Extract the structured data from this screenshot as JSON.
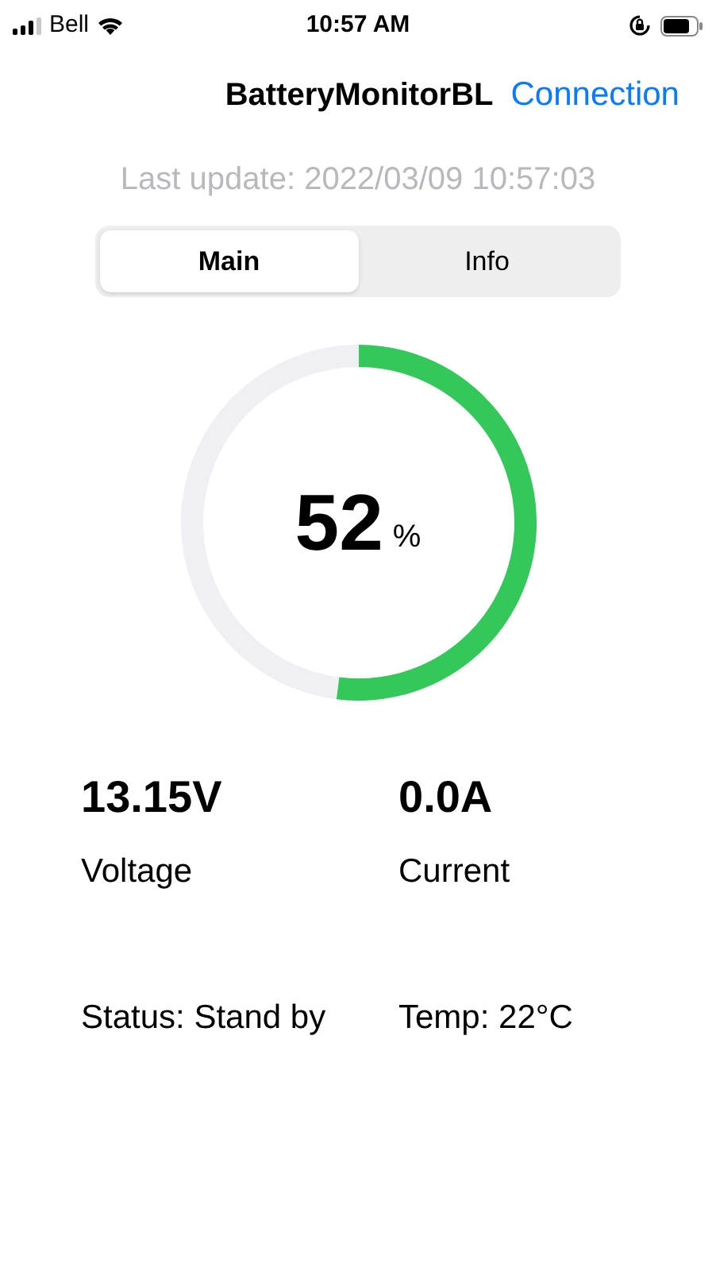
{
  "status_bar": {
    "carrier": "Bell",
    "time": "10:57 AM"
  },
  "nav": {
    "title": "BatteryMonitorBL",
    "action": "Connection"
  },
  "last_update": "Last update: 2022/03/09 10:57:03",
  "segments": [
    {
      "label": "Main",
      "selected": true
    },
    {
      "label": "Info",
      "selected": false
    }
  ],
  "gauge": {
    "value": "52",
    "unit": "%"
  },
  "readings": [
    {
      "value": "13.15V",
      "label": "Voltage"
    },
    {
      "value": "0.0A",
      "label": "Current"
    }
  ],
  "info": [
    "Status: Stand by",
    "Temp: 22°C"
  ]
}
